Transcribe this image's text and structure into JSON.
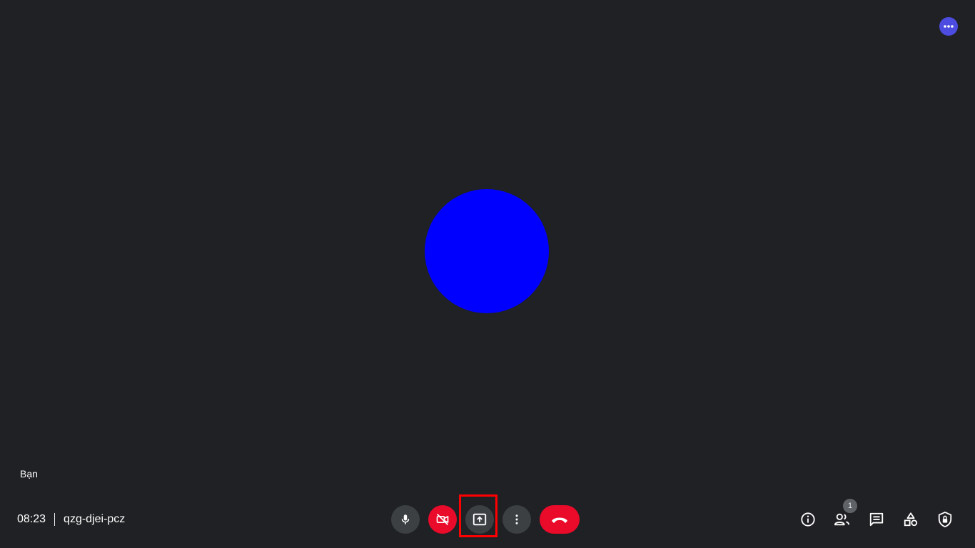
{
  "participant": {
    "self_label": "Bạn",
    "avatar_color": "#0000ff"
  },
  "meeting": {
    "time": "08:23",
    "code": "qzg-djei-pcz"
  },
  "controls": {
    "mic_icon": "microphone-icon",
    "camera_icon": "camera-off-icon",
    "present_icon": "present-screen-icon",
    "more_icon": "more-vertical-icon",
    "end_icon": "hang-up-icon"
  },
  "right_panel": {
    "participants_count": "1",
    "icons": [
      "info-icon",
      "people-icon",
      "chat-icon",
      "activities-icon",
      "host-controls-icon"
    ]
  },
  "colors": {
    "background": "#202124",
    "danger": "#ea0a2a",
    "button_dark": "#3c4043",
    "accent": "#4c4ce0",
    "highlight": "#ff0000"
  }
}
